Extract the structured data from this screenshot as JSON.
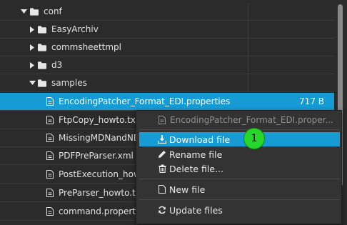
{
  "tree": {
    "rows": [
      {
        "label": "conf",
        "type": "folder",
        "expanded": true,
        "size": ""
      },
      {
        "label": "EasyArchiv",
        "type": "folder",
        "expanded": false,
        "size": ""
      },
      {
        "label": "commsheettmpl",
        "type": "folder",
        "expanded": false,
        "size": ""
      },
      {
        "label": "d3",
        "type": "folder",
        "expanded": false,
        "size": ""
      },
      {
        "label": "samples",
        "type": "folder",
        "expanded": true,
        "size": ""
      },
      {
        "label": "EncodingPatcher_Format_EDI.properties",
        "type": "file",
        "selected": true,
        "size": "717 B"
      },
      {
        "label": "FtpCopy_howto.txt",
        "type": "file",
        "size": ""
      },
      {
        "label": "MissingMDNandNDN",
        "type": "file",
        "size": ""
      },
      {
        "label": "PDFPreParser.xml",
        "type": "file",
        "size": ""
      },
      {
        "label": "PostExecution_howto",
        "type": "file",
        "size": ""
      },
      {
        "label": "PreParser_howto.txt",
        "type": "file",
        "size": ""
      },
      {
        "label": "command.properties",
        "type": "file",
        "size": ""
      }
    ]
  },
  "context_menu": {
    "header": "EncodingPatcher_Format_EDI.proper...",
    "items": {
      "download": "Download file",
      "rename": "Rename file",
      "delete": "Delete file...",
      "new_file": "New file",
      "update": "Update files"
    }
  },
  "step_badge": "1",
  "colors": {
    "background": "#2b2b2b",
    "selection": "#169bd5",
    "badge": "#28d52a"
  },
  "icons": {
    "expanded": "caret-down-icon",
    "collapsed": "caret-right-icon",
    "folder": "folder-icon",
    "file": "file-icon"
  }
}
